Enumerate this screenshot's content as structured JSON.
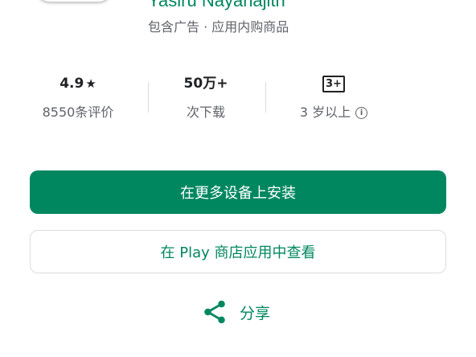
{
  "app": {
    "developer": "Yasiru Nayanajith",
    "meta": "包含广告 · 应用内购商品"
  },
  "stats": {
    "rating": {
      "value": "4.9",
      "star": "★",
      "label": "8550条评价"
    },
    "downloads": {
      "value": "50万+",
      "label": "次下载"
    },
    "content_rating": {
      "badge": "3+",
      "label": "3 岁以上",
      "info_icon": "i"
    }
  },
  "actions": {
    "install_label": "在更多设备上安装",
    "view_label": "在 Play 商店应用中查看",
    "share_label": "分享"
  },
  "colors": {
    "accent": "#01875f",
    "text_primary": "#202124",
    "text_secondary": "#5f6368",
    "divider": "#dadce0"
  },
  "icons": {
    "share": "share-icon",
    "info": "info-icon",
    "star": "star-icon"
  }
}
